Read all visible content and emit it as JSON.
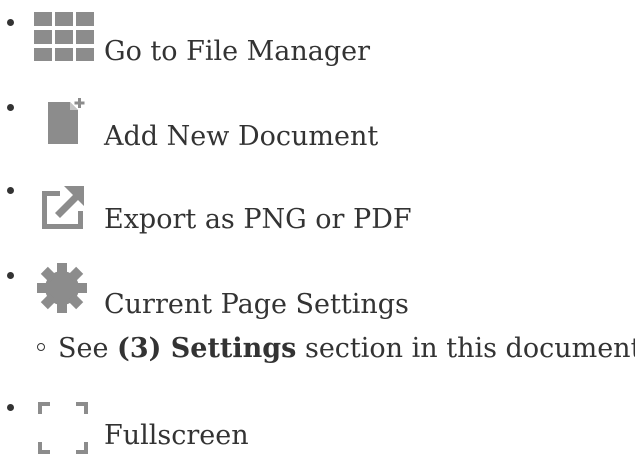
{
  "toolbar_help": {
    "items": [
      {
        "label": "Go to File Manager",
        "icon": "grid-icon"
      },
      {
        "label": "Add New Document",
        "icon": "new-document-icon"
      },
      {
        "label": "Export as PNG or PDF",
        "icon": "export-icon"
      },
      {
        "label": "Current Page Settings",
        "icon": "gear-icon"
      },
      {
        "label": "Fullscreen",
        "icon": "fullscreen-icon"
      }
    ],
    "settings_note": {
      "prefix": "See ",
      "bold": "(3) Settings",
      "suffix": " section in this document."
    }
  },
  "colors": {
    "text": "#333333",
    "icon": "#8c8c8c"
  }
}
